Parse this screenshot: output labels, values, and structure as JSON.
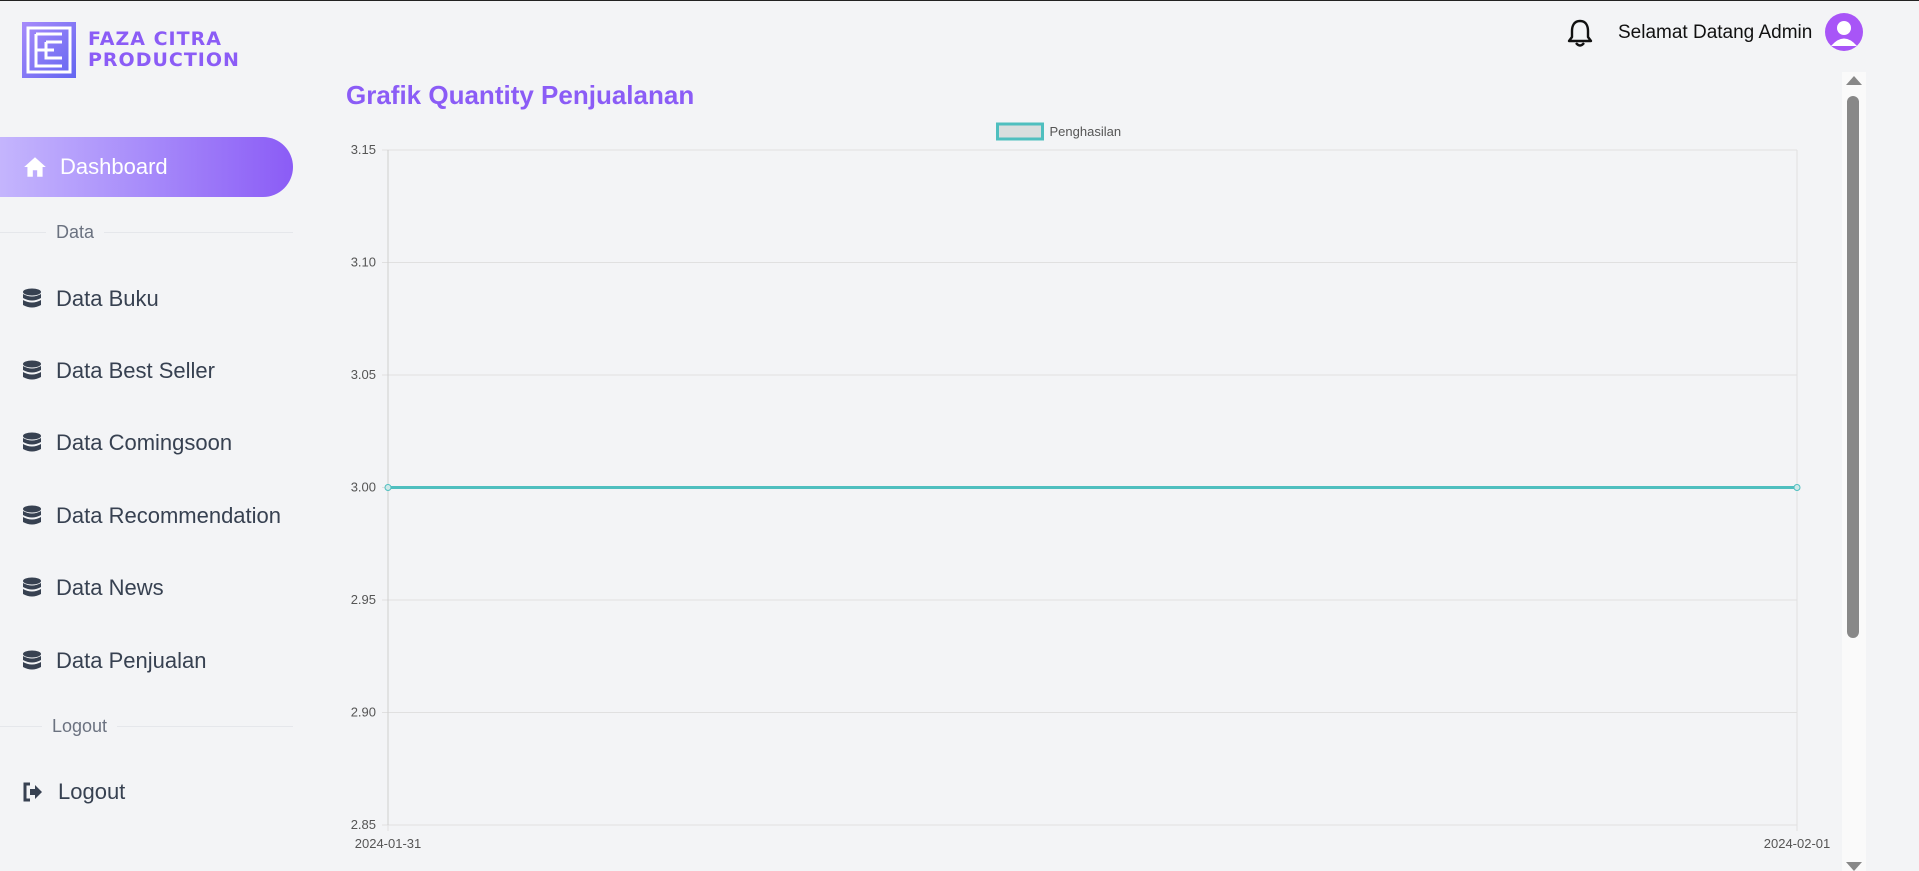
{
  "brand": {
    "line1": "FAZA CITRA",
    "line2": "PRODUCTION",
    "color": "#8b5cf6"
  },
  "header": {
    "welcome": "Selamat Datang Admin"
  },
  "sidebar": {
    "dashboard": {
      "label": "Dashboard",
      "icon": "home-icon"
    },
    "section_data": "Data",
    "items": [
      {
        "label": "Data Buku",
        "icon": "database-icon"
      },
      {
        "label": "Data Best Seller",
        "icon": "database-icon"
      },
      {
        "label": "Data Comingsoon",
        "icon": "database-icon"
      },
      {
        "label": "Data Recommendation",
        "icon": "database-icon"
      },
      {
        "label": "Data News",
        "icon": "database-icon"
      },
      {
        "label": "Data Penjualan",
        "icon": "database-icon"
      }
    ],
    "section_logout": "Logout",
    "logout": {
      "label": "Logout",
      "icon": "sign-out-icon"
    }
  },
  "main": {
    "title": "Grafik Quantity Penjualanan"
  },
  "chart_data": {
    "type": "line",
    "title": "",
    "x": [
      "2024-01-31",
      "2024-02-01"
    ],
    "series": [
      {
        "name": "Penghasilan",
        "values": [
          3,
          3
        ],
        "color": "#4fbfbf"
      }
    ],
    "ylim": [
      2.85,
      3.15
    ],
    "yticks": [
      "3.15",
      "3.10",
      "3.05",
      "3.00",
      "2.95",
      "2.90",
      "2.85"
    ],
    "grid": true,
    "legend": "top-center"
  }
}
